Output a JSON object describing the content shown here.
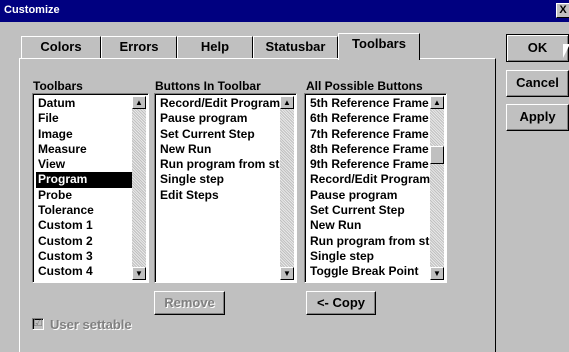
{
  "window": {
    "title": "Customize",
    "close_glyph": "X"
  },
  "tabs": [
    {
      "label": "Colors",
      "active": false
    },
    {
      "label": "Errors",
      "active": false
    },
    {
      "label": "Help",
      "active": false
    },
    {
      "label": "Statusbar",
      "active": false
    },
    {
      "label": "Toolbars",
      "active": true
    }
  ],
  "toolbars": {
    "heading": "Toolbars",
    "items": [
      "Datum",
      "File",
      "Image",
      "Measure",
      "View",
      "Program",
      "Probe",
      "Tolerance",
      "Custom 1",
      "Custom 2",
      "Custom 3",
      "Custom 4"
    ],
    "selected_index": 5
  },
  "buttons_in_toolbar": {
    "heading": "Buttons In Toolbar",
    "items": [
      "Record/Edit Program",
      "Pause program",
      "Set Current Step",
      "New Run",
      "Run program from st",
      "Single step",
      "Edit Steps"
    ]
  },
  "all_possible_buttons": {
    "heading": "All Possible Buttons",
    "items": [
      "5th Reference Frame",
      "6th Reference Frame",
      "7th Reference Frame",
      "8th Reference Frame",
      "9th Reference Frame",
      "Record/Edit Program",
      "Pause program",
      "Set Current Step",
      "New Run",
      "Run program from st",
      "Single step",
      "Toggle Break Point"
    ]
  },
  "buttons": {
    "remove": "Remove",
    "copy": "<- Copy",
    "ok": "OK",
    "cancel": "Cancel",
    "apply": "Apply"
  },
  "checkbox": {
    "label": "User settable",
    "checked": true,
    "mark": "☑"
  },
  "icons": {
    "scroll_up": "▲",
    "scroll_down": "▼"
  },
  "colors": {
    "titlebar": "#000080",
    "face": "#c0c0c0",
    "selection": "#000000"
  }
}
